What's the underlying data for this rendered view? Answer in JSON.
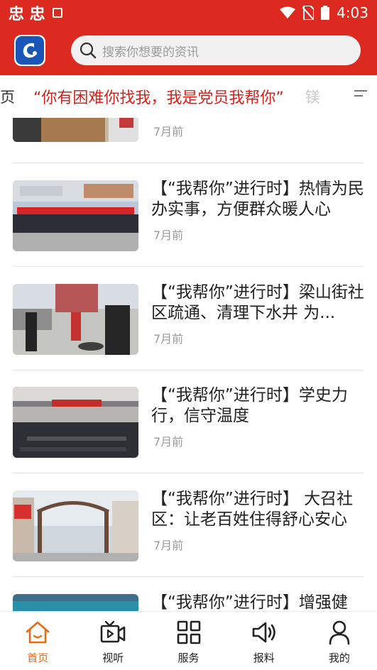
{
  "status_bar": {
    "left_glyphs": "忠 忠",
    "time": "4:03"
  },
  "header": {
    "logo": "app-logo",
    "search_placeholder": "搜索你想要的资讯"
  },
  "ticker": {
    "prefix": "页",
    "headline": "“你有困难你找我，我是党员我帮你”",
    "next": "镁"
  },
  "feed": [
    {
      "title": "",
      "time": "7月前"
    },
    {
      "title": "【“我帮你”进行时】热情为民办实事，方便群众暖人心",
      "time": "7月前"
    },
    {
      "title": "【“我帮你”进行时】梁山街社区疏通、清理下水井  为...",
      "time": "7月前"
    },
    {
      "title": "【“我帮你”进行时】学史力行，信守温度",
      "time": "7月前"
    },
    {
      "title": "【“我帮你”进行时】 大召社区：让老百姓住得舒心安心",
      "time": "7月前"
    },
    {
      "title": "【“我帮你”进行时】增强健",
      "time": ""
    }
  ],
  "bottom_nav": [
    {
      "label": "首页",
      "icon": "home-icon",
      "active": true
    },
    {
      "label": "视听",
      "icon": "video-icon",
      "active": false
    },
    {
      "label": "服务",
      "icon": "grid-icon",
      "active": false
    },
    {
      "label": "报料",
      "icon": "speaker-icon",
      "active": false
    },
    {
      "label": "我的",
      "icon": "profile-icon",
      "active": false
    }
  ],
  "colors": {
    "brand_red": "#dc2a20",
    "headline_red": "#d8211b",
    "active_orange": "#e8691a"
  }
}
